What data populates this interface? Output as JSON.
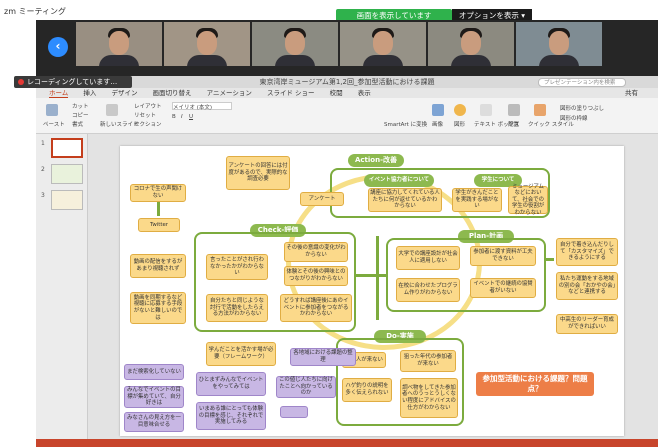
{
  "window": {
    "title": "zm ミーティング"
  },
  "share": {
    "banner": "画面を表示しています",
    "options": "オプションを表示 ▾"
  },
  "recording": {
    "label": "レコーディングしています…"
  },
  "ppt": {
    "doc_title": "東京湾岸ミュージアム第1,2回_参加型活動における課題",
    "search_placeholder": "プレゼンテーション内を検索",
    "tabs": [
      "ホーム",
      "挿入",
      "デザイン",
      "画面切り替え",
      "アニメーション",
      "スライド ショー",
      "校閲",
      "表示"
    ],
    "share_label": "共有",
    "ribbon": {
      "paste": "ペースト",
      "cut": "カット",
      "copy": "コピー",
      "format": "書式",
      "new_slide": "新しいスライド",
      "layout": "レイアウト",
      "reset": "リセット",
      "section": "セクション",
      "font": "メイリオ (本文)",
      "convert_smartart": "SmartArt に変換",
      "image": "画像",
      "shape": "図形",
      "textbox": "テキスト ボックス",
      "arrange": "配置",
      "quick_styles": "クイック スタイル",
      "shape_fill": "図形の塗りつぶし",
      "shape_outline": "図形の枠線"
    },
    "slide_numbers": [
      "1",
      "2",
      "3"
    ]
  },
  "slide": {
    "labels": {
      "action": "Action-改善",
      "check": "Check-評価",
      "plan": "Plan-計画",
      "do": "Do-実施",
      "event_org": "イベント協力者について",
      "students": "学生について"
    },
    "title": "参加型活動における課題？問題点？",
    "boxes": {
      "corona": "コロナで生の声聞けない",
      "twitter": "Twitter",
      "video_tv": "動画の配信をするがあまり視聴されず",
      "video_test": "動画を同期するなど視聴に応募する手段がないと難しいのでは",
      "survey_old": "アンケートの回答には付度があるので、実際的な調査必要",
      "survey": "アンケート",
      "said_other": "言ったことがされ行わなかったかがわからない",
      "participant_impression": "その後の意識の変化がわからない",
      "experience": "体験とその後の興味とのつながりがわからない",
      "eval_method": "自分たちと同じような討行で活動をしたらえる方法がわからない",
      "how_event": "どうすれば講座後にあのイベントに参加者をつながるかわからない",
      "event_coop": "講座に協力してくれている人たちに何が返せているかわからない",
      "students_fun": "学生がきんだことを実践する場がない",
      "museum_not": "ミュージアムなどにおいて、社会での学生の役割がわからない",
      "university_lecture": "大学での講座設計が社会人に適用しない",
      "participant_materials": "参加者に渡す資料が工夫できない",
      "program": "在校に合わせたプログラム作りがわからない",
      "event_sponsors": "イベントでの継続の協賛者がいない",
      "self_think": "自分で着き込んだりして「カスタマイズ」できるようにする",
      "lc": "私たち運動をする地域の別の会「おかやの会」などと連携する",
      "school_leader": "中高生のリーダー育成ができればいい",
      "young": "若い人が来ない",
      "age_fixed": "狙った年代の参加者が来ない",
      "explanation": "ハゲ釣りの説明を多く伝えられない",
      "investigate": "調べ物をしてきた参加者へのうっとうしくない程度にアドバイスの仕方がわからない",
      "change_learning": "学んだことを活かす場が必要（フレームワーク）",
      "regional_issue": "各地域における課題の整理",
      "p1": "まだ検索化していない",
      "p2": "ひとまずみんなでイベントをやってみては",
      "p3": "この値じ人たちに向けたことへ向かっているのか",
      "p4": "みんなでイベントの目標が集めていて、自分好きは",
      "p5": "いまある誰にとっても体験の目標を感じ、それぞれで実施してみる",
      "p6": "みなさんの見え方を一目意味合せる"
    }
  }
}
